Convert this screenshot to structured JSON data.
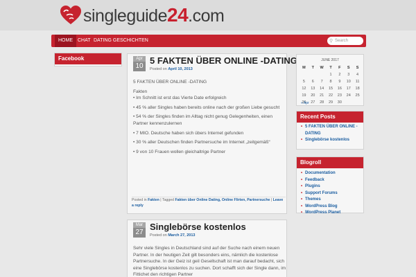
{
  "site": {
    "logo_text": "singleguide",
    "logo_number": "24",
    "logo_domain": ".com"
  },
  "nav": {
    "items": [
      "HOME",
      "CHAT",
      "DATING GESCHICHTEN"
    ],
    "search_placeholder": "Search"
  },
  "left_sidebar": {
    "facebook_title": "Facebook"
  },
  "posts": [
    {
      "month": "Apr",
      "day": "10",
      "title": "5 FAKTEN ÜBER ONLINE -DATING",
      "posted_on": "Posted on",
      "date": "April 10, 2013",
      "paragraphs": [
        "5 FAKTEN ÜBER ONLINE -DATING",
        "Fakten\n• Im Schnitt ist erst das Vierte Date erfolgreich",
        "• 45 % aller Singles haben bereits online nach der großen Liebe gesucht",
        "• 54 % der Singles finden im Alltag nicht genug Gelegenheiten, einen Partner kennenzulernen",
        "• 7 MIO. Deutsche haben sich übers Internet gefunden",
        "• 30 % aller Deutschen finden Partnersuche im Internet „zeitgemäß“",
        "• 9 von 10 Frauen wollen gleichaltrige Partner"
      ],
      "footer": {
        "posted_in": "Posted in",
        "category": "Fakten",
        "tagged": "| Tagged",
        "tags": "Fakten über Online Dating, Online Flirten, Partnersuche",
        "sep": " | ",
        "reply": "Leave a reply"
      }
    },
    {
      "month": "Mar",
      "day": "27",
      "title": "Singlebörse kostenlos",
      "posted_on": "Posted on",
      "date": "March 27, 2013",
      "body": "Sehr viele Singles in Deutschland sind auf der Suche nach einem neuen Partner. In der heutigen Zeit gilt besonders eins, nämlich die kostenlose Partnersuche. In der Geiz ist geil Gesellschaft ist man darauf bedacht, sich eine Singlebörse kostenlos zu suchen. Dort schafft sich der Single dann, im Fittichet den richtigen Partner"
    }
  ],
  "calendar": {
    "caption": "JUNE 2017",
    "days": [
      "M",
      "T",
      "W",
      "T",
      "F",
      "S",
      "S"
    ],
    "weeks": [
      [
        "",
        "",
        "",
        "1",
        "2",
        "3",
        "4"
      ],
      [
        "5",
        "6",
        "7",
        "8",
        "9",
        "10",
        "11"
      ],
      [
        "12",
        "13",
        "14",
        "15",
        "16",
        "17",
        "18"
      ],
      [
        "19",
        "20",
        "21",
        "22",
        "23",
        "24",
        "25"
      ],
      [
        "26",
        "27",
        "28",
        "29",
        "30",
        "",
        ""
      ]
    ],
    "prev": "« Apr"
  },
  "recent_posts": {
    "title": "Recent Posts",
    "items": [
      "5 FAKTEN ÜBER ONLINE -DATING",
      "Singlebörse kostenlos"
    ]
  },
  "blogroll": {
    "title": "Blogroll",
    "items": [
      "Documentation",
      "Feedback",
      "Plugins",
      "Support Forums",
      "Themes",
      "WordPress Blog",
      "WordPress Planet"
    ]
  },
  "colors": {
    "brand_red": "#c6232f",
    "link_blue": "#1a5da0"
  }
}
